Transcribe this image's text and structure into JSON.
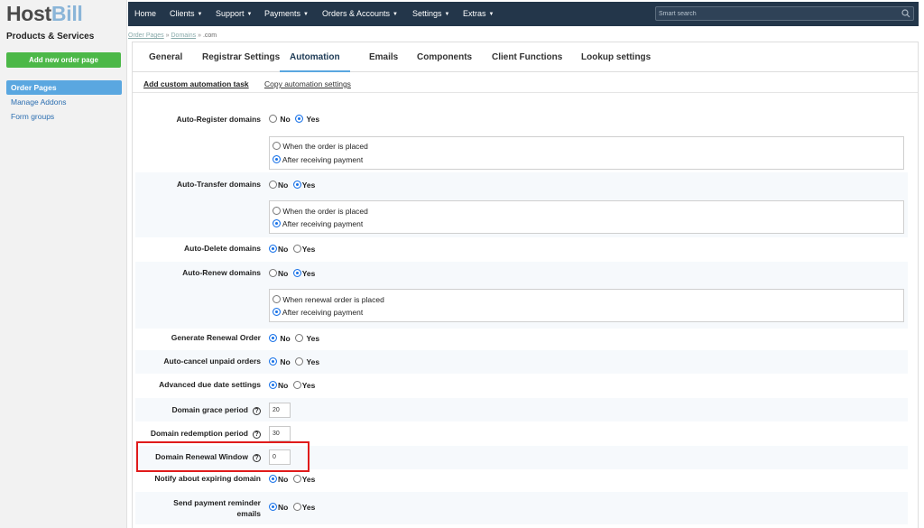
{
  "app": {
    "logo_part1": "Host",
    "logo_part2": "Bill",
    "sidebar_title": "Products & Services",
    "add_button": "Add new order page"
  },
  "sidebar": {
    "items": [
      {
        "label": "Order Pages",
        "active": true
      },
      {
        "label": "Manage Addons",
        "active": false
      },
      {
        "label": "Form groups",
        "active": false
      }
    ]
  },
  "topnav": {
    "items": [
      {
        "label": "Home",
        "dropdown": false
      },
      {
        "label": "Clients",
        "dropdown": true
      },
      {
        "label": "Support",
        "dropdown": true
      },
      {
        "label": "Payments",
        "dropdown": true
      },
      {
        "label": "Orders & Accounts",
        "dropdown": true
      },
      {
        "label": "Settings",
        "dropdown": true
      },
      {
        "label": "Extras",
        "dropdown": true
      }
    ],
    "search_placeholder": "Smart search",
    "search_icon": "search-icon",
    "caret_glyph": "▼"
  },
  "breadcrumb": {
    "items": [
      "Order Pages",
      "Domains"
    ],
    "separator": "»",
    "current": ".com"
  },
  "tabs": [
    {
      "label": "General",
      "active": false
    },
    {
      "label": "Registrar Settings",
      "active": false
    },
    {
      "label": "Automation",
      "active": true
    },
    {
      "label": "Emails",
      "active": false
    },
    {
      "label": "Components",
      "active": false
    },
    {
      "label": "Client Functions",
      "active": false
    },
    {
      "label": "Lookup settings",
      "active": false
    }
  ],
  "subtabs": {
    "add_task": "Add custom automation task",
    "copy": "Copy automation settings"
  },
  "settings": {
    "auto_register": {
      "label": "Auto-Register domains",
      "no": "No",
      "yes": "Yes",
      "selected": "Yes",
      "sub_when_placed": "When the order is placed",
      "sub_after_payment": "After receiving payment",
      "sub_selected": "after_payment"
    },
    "auto_transfer": {
      "label": "Auto-Transfer domains",
      "no": "No",
      "yes": "Yes",
      "selected": "Yes",
      "sub_when_placed": "When the order is placed",
      "sub_after_payment": "After receiving payment",
      "sub_selected": "after_payment"
    },
    "auto_delete": {
      "label": "Auto-Delete domains",
      "no": "No",
      "yes": "Yes",
      "selected": "No"
    },
    "auto_renew": {
      "label": "Auto-Renew domains",
      "no": "No",
      "yes": "Yes",
      "selected": "Yes",
      "sub_when_placed": "When renewal order is placed",
      "sub_after_payment": "After receiving payment",
      "sub_selected": "after_payment"
    },
    "generate_renewal": {
      "label": "Generate Renewal Order",
      "no": "No",
      "yes": "Yes",
      "selected": "No"
    },
    "auto_cancel": {
      "label": "Auto-cancel unpaid orders",
      "no": "No",
      "yes": "Yes",
      "selected": "No"
    },
    "advanced_due": {
      "label": "Advanced due date settings",
      "no": "No",
      "yes": "Yes",
      "selected": "No"
    },
    "grace_period": {
      "label": "Domain grace period",
      "value": "20"
    },
    "redemption_period": {
      "label": "Domain redemption period",
      "value": "30"
    },
    "renewal_window": {
      "label": "Domain Renewal Window",
      "value": "0"
    },
    "notify_expiring": {
      "label": "Notify about expiring domain",
      "no": "No",
      "yes": "Yes",
      "selected": "No"
    },
    "payment_reminder": {
      "label_line1": "Send payment reminder",
      "label_line2": "emails",
      "no": "No",
      "yes": "Yes",
      "selected": "No"
    },
    "help_glyph": "?"
  },
  "colors": {
    "topbar": "#23364a",
    "accent_blue": "#5aa7e0",
    "add_button": "#4cb848",
    "highlight": "#e01b1b"
  }
}
